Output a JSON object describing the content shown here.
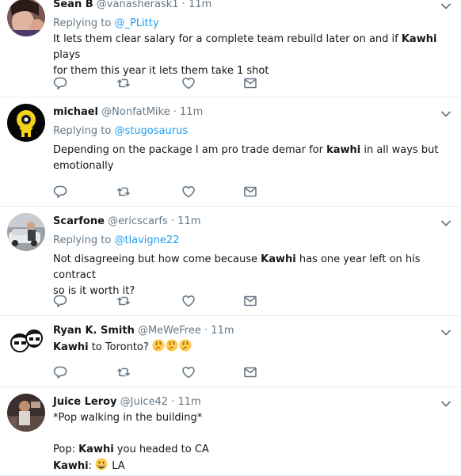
{
  "colors": {
    "accent": "#1da1f2",
    "muted": "#657786",
    "text": "#14171a",
    "divider": "#e6ecf0"
  },
  "tweets": [
    {
      "name": "Sean B",
      "handle": "@vanasherask1",
      "dot": "·",
      "time": "11m",
      "reply_prefix": "Replying to ",
      "reply_to": "@_PLitty",
      "lines": [
        {
          "segments": [
            {
              "t": "It lets them clear salary for a complete team rebuild later on and if "
            },
            {
              "t": "Kawhi",
              "b": true
            },
            {
              "t": " plays"
            }
          ]
        },
        {
          "segments": [
            {
              "t": "for them this year it lets them take 1 shot"
            }
          ]
        }
      ]
    },
    {
      "name": "michael",
      "handle": "@NonfatMike",
      "dot": "·",
      "time": "11m",
      "reply_prefix": "Replying to ",
      "reply_to": "@stugosaurus",
      "lines": [
        {
          "segments": [
            {
              "t": "Depending on the package I am pro trade demar for "
            },
            {
              "t": "kawhi",
              "b": true
            },
            {
              "t": " in all ways but"
            }
          ]
        },
        {
          "segments": [
            {
              "t": "emotionally"
            }
          ]
        }
      ]
    },
    {
      "name": "Scarfone",
      "handle": "@ericscarfs",
      "dot": "·",
      "time": "11m",
      "reply_prefix": "Replying to ",
      "reply_to": "@tlavigne22",
      "lines": [
        {
          "segments": [
            {
              "t": "Not disagreeing but how come because "
            },
            {
              "t": "Kawhi",
              "b": true
            },
            {
              "t": " has one year left on his contract"
            }
          ]
        },
        {
          "segments": [
            {
              "t": "so is it worth it?"
            }
          ]
        }
      ]
    },
    {
      "name": "Ryan K. Smith",
      "handle": "@MeWeFree",
      "dot": "·",
      "time": "11m",
      "reply_prefix": "",
      "reply_to": "",
      "lines": [
        {
          "segments": [
            {
              "t": "Kawhi",
              "b": true
            },
            {
              "t": " to Toronto? "
            },
            {
              "emoji": "thinking-face-icon"
            },
            {
              "emoji": "thinking-face-icon"
            },
            {
              "emoji": "thinking-face-icon"
            }
          ]
        }
      ]
    },
    {
      "name": "Juice Leroy",
      "handle": "@Juice42",
      "dot": "·",
      "time": "11m",
      "reply_prefix": "",
      "reply_to": "",
      "lines": [
        {
          "segments": [
            {
              "t": "*Pop walking in the building*"
            }
          ]
        },
        {
          "segments": [
            {
              "t": ""
            }
          ]
        },
        {
          "segments": [
            {
              "t": "Pop: "
            },
            {
              "t": "Kawhi",
              "b": true
            },
            {
              "t": " you headed to CA"
            }
          ]
        },
        {
          "segments": [
            {
              "t": "Kawhi",
              "b": true
            },
            {
              "t": ": "
            },
            {
              "emoji": "grinning-face-icon"
            },
            {
              "t": " LA"
            }
          ]
        }
      ]
    }
  ]
}
